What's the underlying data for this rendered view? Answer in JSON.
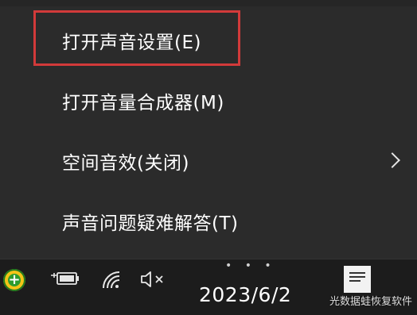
{
  "menu": {
    "items": [
      {
        "label": "打开声音设置(E)",
        "highlighted": true,
        "has_submenu": false
      },
      {
        "label": "打开音量合成器(M)",
        "highlighted": false,
        "has_submenu": false
      },
      {
        "label": "空间音效(关闭)",
        "highlighted": false,
        "has_submenu": true
      },
      {
        "label": "声音问题疑难解答(T)",
        "highlighted": false,
        "has_submenu": false
      }
    ],
    "highlight_color": "#d23a3a"
  },
  "taskbar": {
    "icons": [
      "360-security-icon",
      "battery-charging-icon",
      "wifi-icon",
      "volume-muted-icon"
    ],
    "date": "2023/6/2",
    "notification_icon": "notification-icon"
  },
  "watermark": {
    "text": "光数据蛙恢复软件"
  }
}
